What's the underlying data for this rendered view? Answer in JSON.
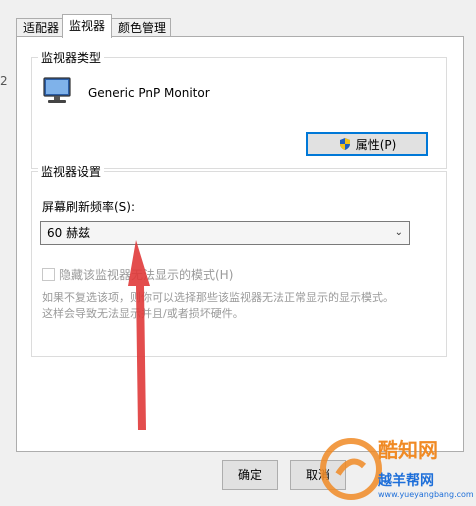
{
  "tabs": [
    {
      "label": "适配器",
      "active": false
    },
    {
      "label": "监视器",
      "active": true
    },
    {
      "label": "颜色管理",
      "active": false
    }
  ],
  "side_number": "2",
  "monitor_type": {
    "group_title": "监视器类型",
    "monitor_name": "Generic PnP Monitor",
    "properties_button": "属性(P)",
    "icon": "monitor-icon"
  },
  "monitor_settings": {
    "group_title": "监视器设置",
    "refresh_label": "屏幕刷新频率(S):",
    "refresh_value": "60 赫兹",
    "hide_modes_label": "隐藏该监视器无法显示的模式(H)",
    "hide_modes_checked": false,
    "hint_lines": [
      "如果不复选该项，则你可以选择那些该监视器无法正常显示的显示模式。",
      "这样会导致无法显示并且/或者损坏硬件。"
    ]
  },
  "bottom_buttons": [
    "确定",
    "取消"
  ],
  "watermark": {
    "brand": "酷知网",
    "site": "越羊帮网",
    "url": "www.yueyangbang.com"
  },
  "colors": {
    "accent": "#0078d7",
    "arrow": "#e03a3a",
    "watermark_orange": "#f08a24",
    "watermark_blue": "#1e6fd9"
  }
}
